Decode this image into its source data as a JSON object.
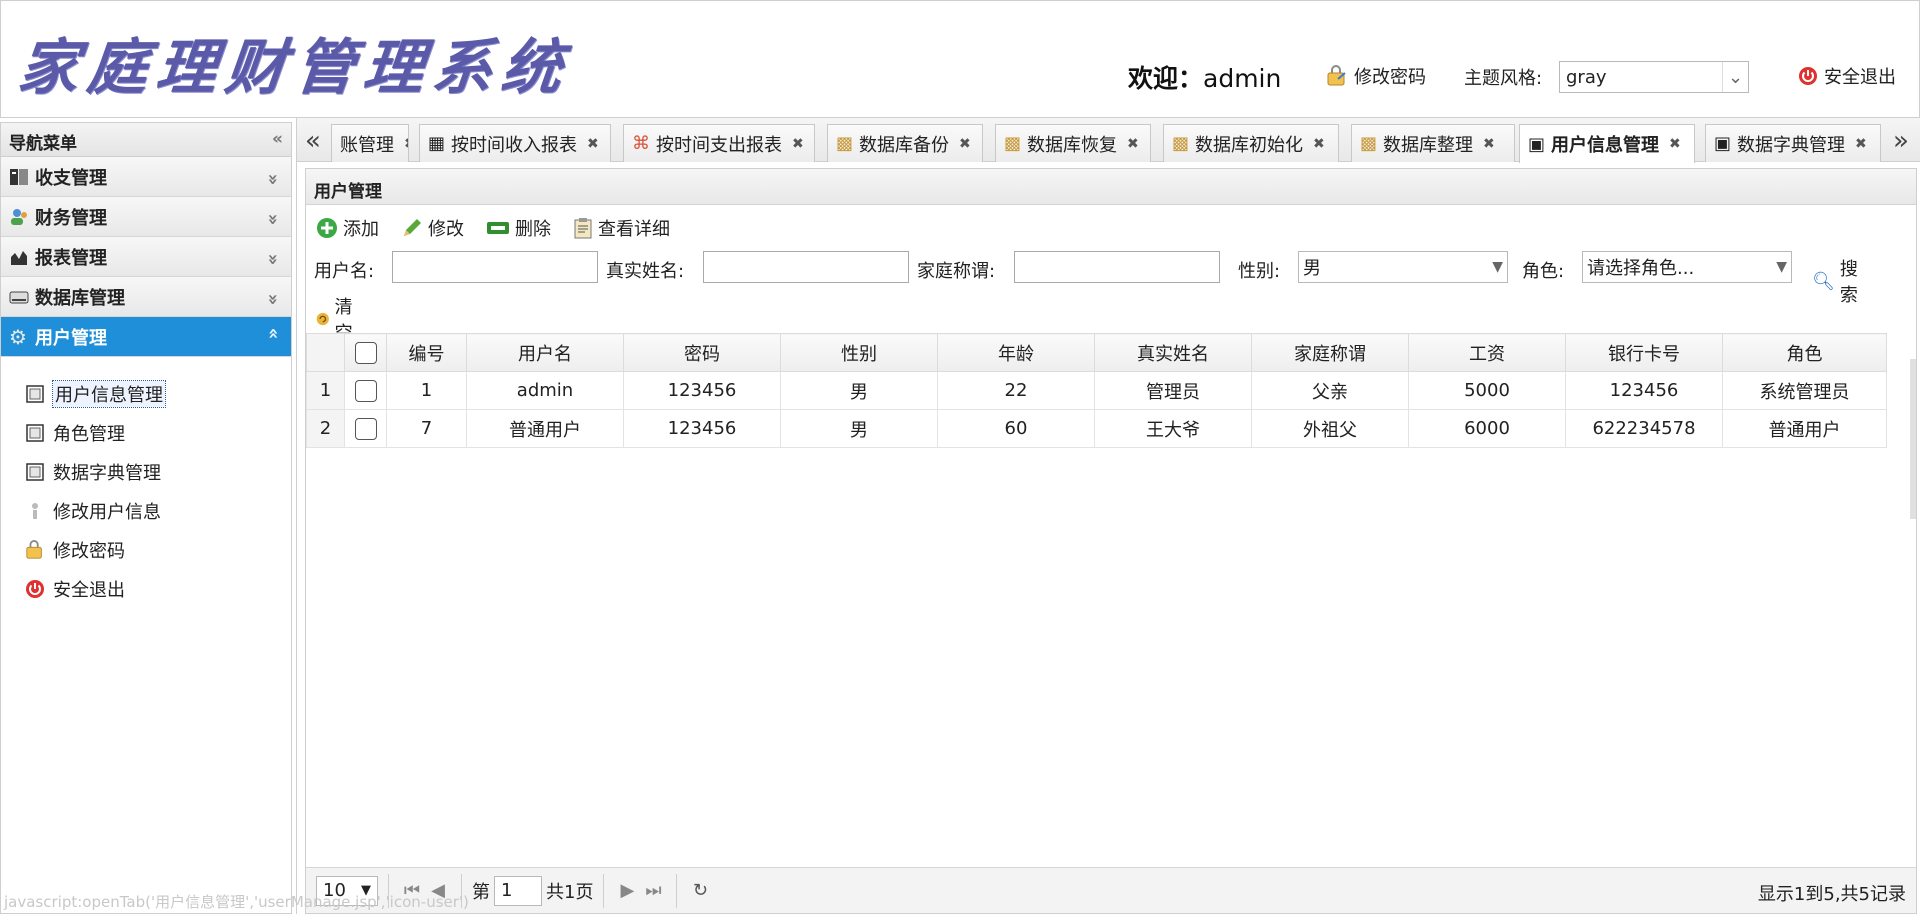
{
  "app": {
    "logo_text": "家庭理财管理系统",
    "welcome_prefix": "欢迎：",
    "username": "admin",
    "change_password": "修改密码",
    "theme_label": "主题风格:",
    "theme_value": "gray",
    "logout": "安全退出"
  },
  "sidebar": {
    "title": "导航菜单",
    "sections": [
      {
        "label": "收支管理",
        "icon": "ledger-icon"
      },
      {
        "label": "财务管理",
        "icon": "users-icon"
      },
      {
        "label": "报表管理",
        "icon": "chart-icon"
      },
      {
        "label": "数据库管理",
        "icon": "drive-icon"
      },
      {
        "label": "用户管理",
        "icon": "gear-icon"
      }
    ],
    "items": [
      {
        "label": "用户信息管理"
      },
      {
        "label": "角色管理"
      },
      {
        "label": "数据字典管理"
      },
      {
        "label": "修改用户信息"
      },
      {
        "label": "修改密码"
      },
      {
        "label": "安全退出"
      }
    ]
  },
  "tabs": [
    {
      "label": "账管理"
    },
    {
      "label": "按时间收入报表"
    },
    {
      "label": "按时间支出报表"
    },
    {
      "label": "数据库备份"
    },
    {
      "label": "数据库恢复"
    },
    {
      "label": "数据库初始化"
    },
    {
      "label": "数据库整理"
    },
    {
      "label": "用户信息管理"
    },
    {
      "label": "数据字典管理"
    }
  ],
  "panel": {
    "title": "用户管理",
    "toolbar": {
      "add": "添加",
      "edit": "修改",
      "delete": "删除",
      "detail": "查看详细"
    },
    "filters": {
      "username_label": "用户名:",
      "realname_label": "真实姓名:",
      "family_label": "家庭称谓:",
      "gender_label": "性别:",
      "gender_value": "男",
      "role_label": "角色:",
      "role_value": "请选择角色...",
      "search": "搜索",
      "clear": "清空"
    },
    "table": {
      "columns": [
        "编号",
        "用户名",
        "密码",
        "性别",
        "年龄",
        "真实姓名",
        "家庭称谓",
        "工资",
        "银行卡号",
        "角色"
      ],
      "rows": [
        {
          "rownum": "1",
          "cells": [
            "1",
            "admin",
            "123456",
            "男",
            "22",
            "管理员",
            "父亲",
            "5000",
            "123456",
            "系统管理员"
          ]
        },
        {
          "rownum": "2",
          "cells": [
            "7",
            "普通用户",
            "123456",
            "男",
            "60",
            "王大爷",
            "外祖父",
            "6000",
            "622234578",
            "普通用户"
          ]
        }
      ]
    },
    "pager": {
      "page_size": "10",
      "page_prefix": "第",
      "page_value": "1",
      "page_total": "共1页",
      "info": "显示1到5,共5记录"
    }
  },
  "status_text": "javascript:openTab('用户信息管理','userManage.jsp','icon-user')",
  "colors": {
    "accent": "#1e8fd8",
    "logo": "#5a5aa8"
  }
}
